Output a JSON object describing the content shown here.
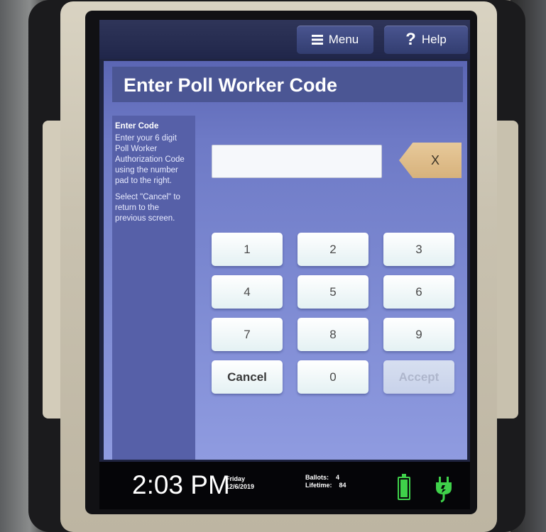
{
  "topbar": {
    "menu_label": "Menu",
    "help_label": "Help",
    "help_glyph": "?"
  },
  "header": {
    "title": "Enter Poll Worker Code"
  },
  "sidebar": {
    "title": "Enter Code",
    "instruction": "Enter your 6 digit Poll Worker Authorization Code using the number pad to the right.",
    "cancel_note": "Select \"Cancel\" to return to the previous screen."
  },
  "code_input": {
    "value": ""
  },
  "clear_button": {
    "label": "X"
  },
  "keypad": {
    "keys": [
      "1",
      "2",
      "3",
      "4",
      "5",
      "6",
      "7",
      "8",
      "9"
    ],
    "cancel": "Cancel",
    "zero": "0",
    "accept": "Accept"
  },
  "status": {
    "time": "2:03 PM",
    "day": "Friday",
    "date": "12/6/2019",
    "ballots_label": "Ballots:",
    "ballots_value": "4",
    "lifetime_label": "Lifetime:",
    "lifetime_value": "84",
    "battery_icon": "battery-icon",
    "power_icon": "plug-icon",
    "accent_color": "#3fd14a"
  }
}
